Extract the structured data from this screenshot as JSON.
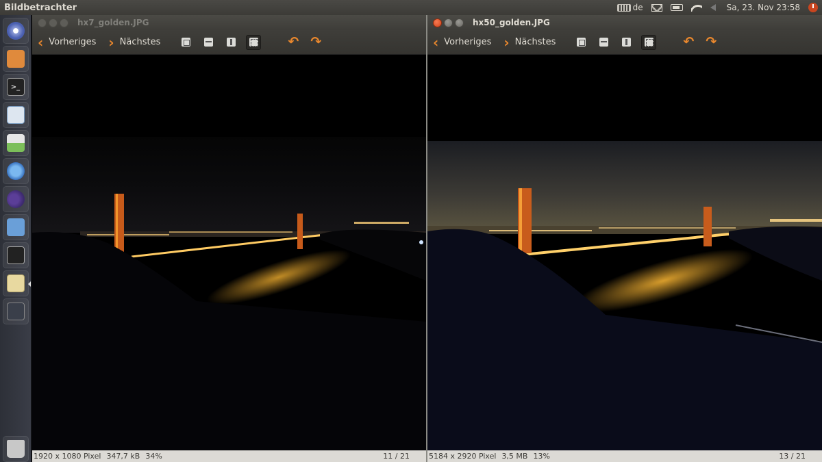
{
  "panel": {
    "app_name": "Bildbetrachter",
    "keyboard_layout": "de",
    "clock": "Sa, 23. Nov 23:58",
    "icons": [
      "keyboard-icon",
      "mail-icon",
      "battery-icon",
      "wifi-icon",
      "volume-icon",
      "power-icon"
    ]
  },
  "launcher": {
    "items": [
      {
        "name": "ubuntu-dash",
        "icon": "ubuntu-logo-icon"
      },
      {
        "name": "files",
        "icon": "files-icon"
      },
      {
        "name": "terminal",
        "icon": "terminal-icon",
        "glyph": ">_"
      },
      {
        "name": "document-viewer",
        "icon": "document-icon"
      },
      {
        "name": "image-viewer",
        "icon": "image-viewer-icon"
      },
      {
        "name": "firefox",
        "icon": "firefox-icon"
      },
      {
        "name": "eclipse",
        "icon": "eclipse-icon"
      },
      {
        "name": "virtualbox",
        "icon": "virtualbox-icon"
      },
      {
        "name": "camera",
        "icon": "camera-icon"
      },
      {
        "name": "software-center",
        "icon": "software-center-icon"
      },
      {
        "name": "workspaces",
        "icon": "workspace-switcher-icon"
      },
      {
        "name": "trash",
        "icon": "trash-icon"
      }
    ]
  },
  "viewers": {
    "left": {
      "filename": "hx7_golden.JPG",
      "prev_label": "Vorheriges",
      "next_label": "Nächstes",
      "dimensions": "1920 x 1080 Pixel",
      "filesize": "347,7 kB",
      "zoom": "34%",
      "counter": "11 / 21",
      "active": false
    },
    "right": {
      "filename": "hx50_golden.JPG",
      "prev_label": "Vorheriges",
      "next_label": "Nächstes",
      "dimensions": "5184 x 2920 Pixel",
      "filesize": "3,5 MB",
      "zoom": "13%",
      "counter": "13 / 21",
      "active": true
    }
  },
  "toolbar_icons": [
    "zoom-fit-icon",
    "zoom-normal-icon",
    "zoom-in-icon",
    "fullscreen-icon",
    "rotate-left-icon",
    "rotate-right-icon"
  ],
  "colors": {
    "accent_orange": "#e8872d",
    "close_button": "#e0522a",
    "panel_bg": "#3c3b37",
    "statusbar_bg": "#dcdad5"
  }
}
